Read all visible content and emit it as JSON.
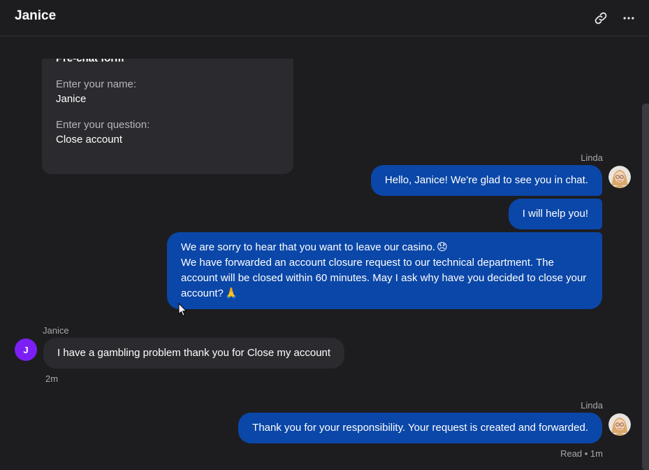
{
  "header": {
    "title": "Janice",
    "icons": [
      "link-icon",
      "more-icon"
    ]
  },
  "form": {
    "title": "Pre-chat form",
    "name_label": "Enter your name:",
    "name_value": "Janice",
    "question_label": "Enter your question:",
    "question_value": "Close account"
  },
  "messages": {
    "agent_name": "Linda",
    "visitor_name": "Janice",
    "visitor_initial": "J",
    "m1": "Hello, Janice! We're glad to see you in chat.",
    "m2": "I will help you!",
    "m3_line1": "We are sorry to hear that you want to leave our casino.",
    "m3_line2": "We have forwarded an account closure request to our technical department. The account will be closed within 60 minutes. May I ask why have you decided to close your account?",
    "m4": "I have a gambling problem thank you for Close my account",
    "m4_time": "2m",
    "m5": "Thank you for your responsibility. Your request is created and forwarded.",
    "m5_status": "Read • 1m"
  },
  "colors": {
    "agent_bubble": "#0b47a8",
    "visitor_bubble": "#2b2b2f",
    "visitor_avatar": "#7c1ff5",
    "background": "#1d1d20"
  }
}
